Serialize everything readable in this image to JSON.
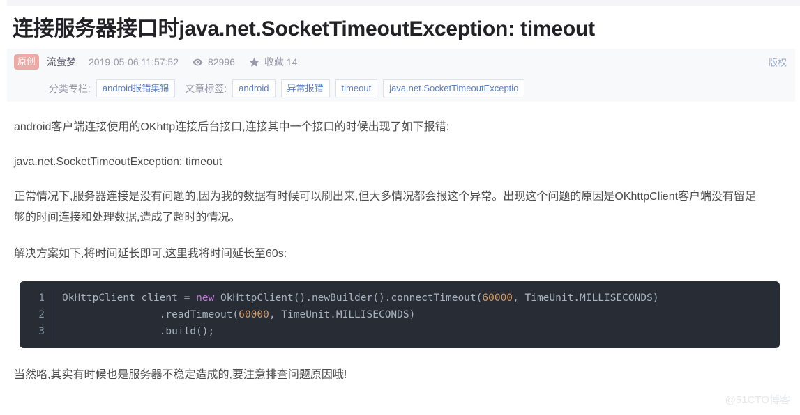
{
  "article": {
    "title": "连接服务器接口时java.net.SocketTimeoutException: timeout",
    "meta": {
      "original_badge": "原创",
      "author": "流萤梦",
      "publish_time": "2019-05-06 11:57:52",
      "views_icon": "eye-icon",
      "views": "82996",
      "favorites_icon": "star-icon",
      "favorites": "收藏 14",
      "copyright": "版权"
    },
    "taxonomy": {
      "category_label": "分类专栏:",
      "categories": [
        "android报错集锦"
      ],
      "tags_label": "文章标签:",
      "tags": [
        "android",
        "异常报错",
        "timeout",
        "java.net.SocketTimeoutExceptio"
      ]
    },
    "paragraphs": [
      "android客户端连接使用的OKhttp连接后台接口,连接其中一个接口的时候出现了如下报错:",
      "java.net.SocketTimeoutException: timeout",
      "正常情况下,服务器连接是没有问题的,因为我的数据有时候可以刷出来,但大多情况都会报这个异常。出现这个问题的原因是OKhttpClient客户端没有留足够的时间连接和处理数据,造成了超时的情况。",
      "解决方案如下,将时间延长即可,这里我将时间延长至60s:",
      "当然咯,其实有时候也是服务器不稳定造成的,要注意排查问题原因哦!"
    ],
    "code_block": {
      "line_numbers": [
        "1",
        "2",
        "3"
      ],
      "lines": [
        "OkHttpClient client = new OkHttpClient().newBuilder().connectTimeout(60000, TimeUnit.MILLISECONDS)",
        "                .readTimeout(60000, TimeUnit.MILLISECONDS)",
        "                .build();"
      ],
      "keyword": "new",
      "numbers": [
        "60000",
        "60000"
      ],
      "background": "#282c34",
      "keyword_color": "#c678dd",
      "number_color": "#d19a66",
      "text_color": "#abb2bf"
    },
    "watermark": "@51CTO博客"
  }
}
